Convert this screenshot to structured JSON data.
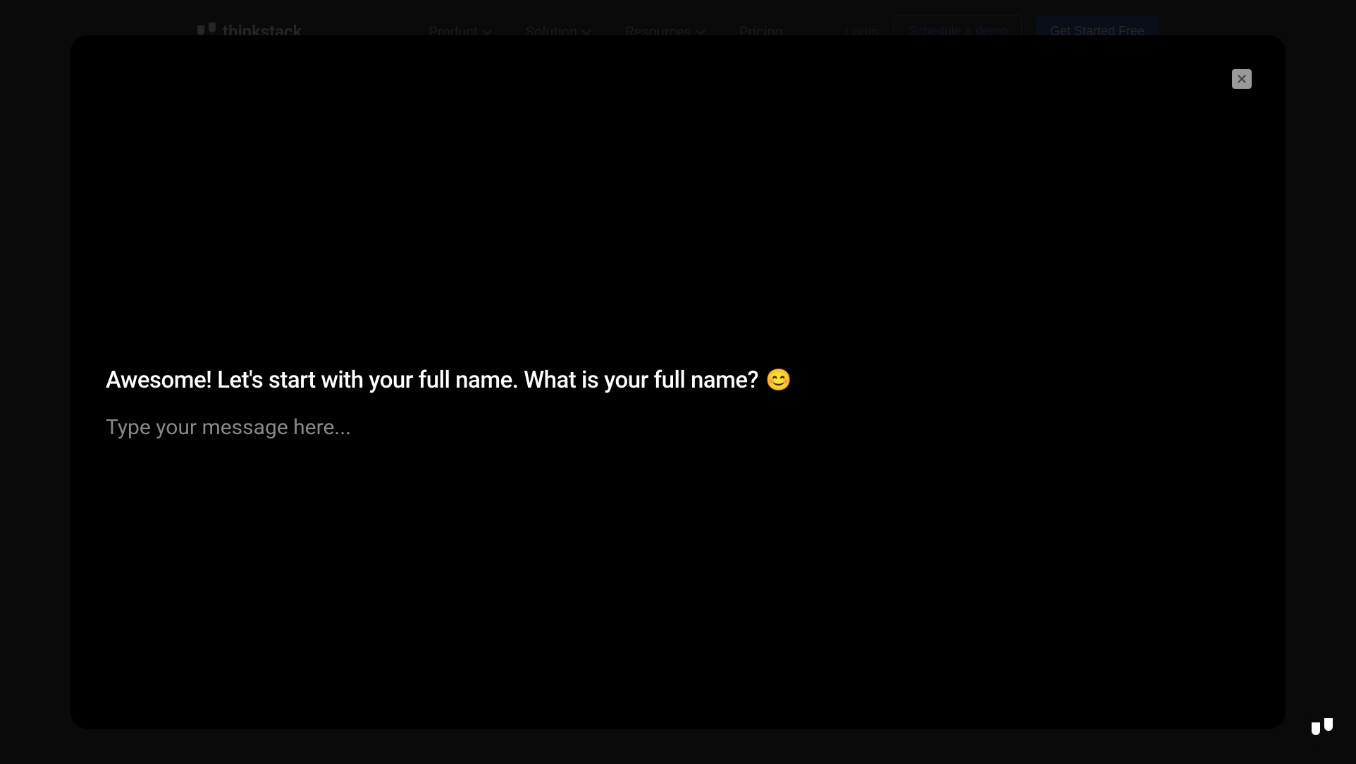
{
  "header": {
    "logo_text": "thinkstack",
    "nav": [
      {
        "label": "Product",
        "has_dropdown": true
      },
      {
        "label": "Solution",
        "has_dropdown": true
      },
      {
        "label": "Resources",
        "has_dropdown": true
      },
      {
        "label": "Pricing",
        "has_dropdown": false
      }
    ],
    "login_label": "Login",
    "schedule_demo_label": "Schedule a demo",
    "get_started_label": "Get Started Free"
  },
  "modal": {
    "prompt_text": "Awesome! Let's start with your full name. What is your full name?",
    "prompt_emoji": "😊",
    "input_placeholder": "Type your message here..."
  }
}
